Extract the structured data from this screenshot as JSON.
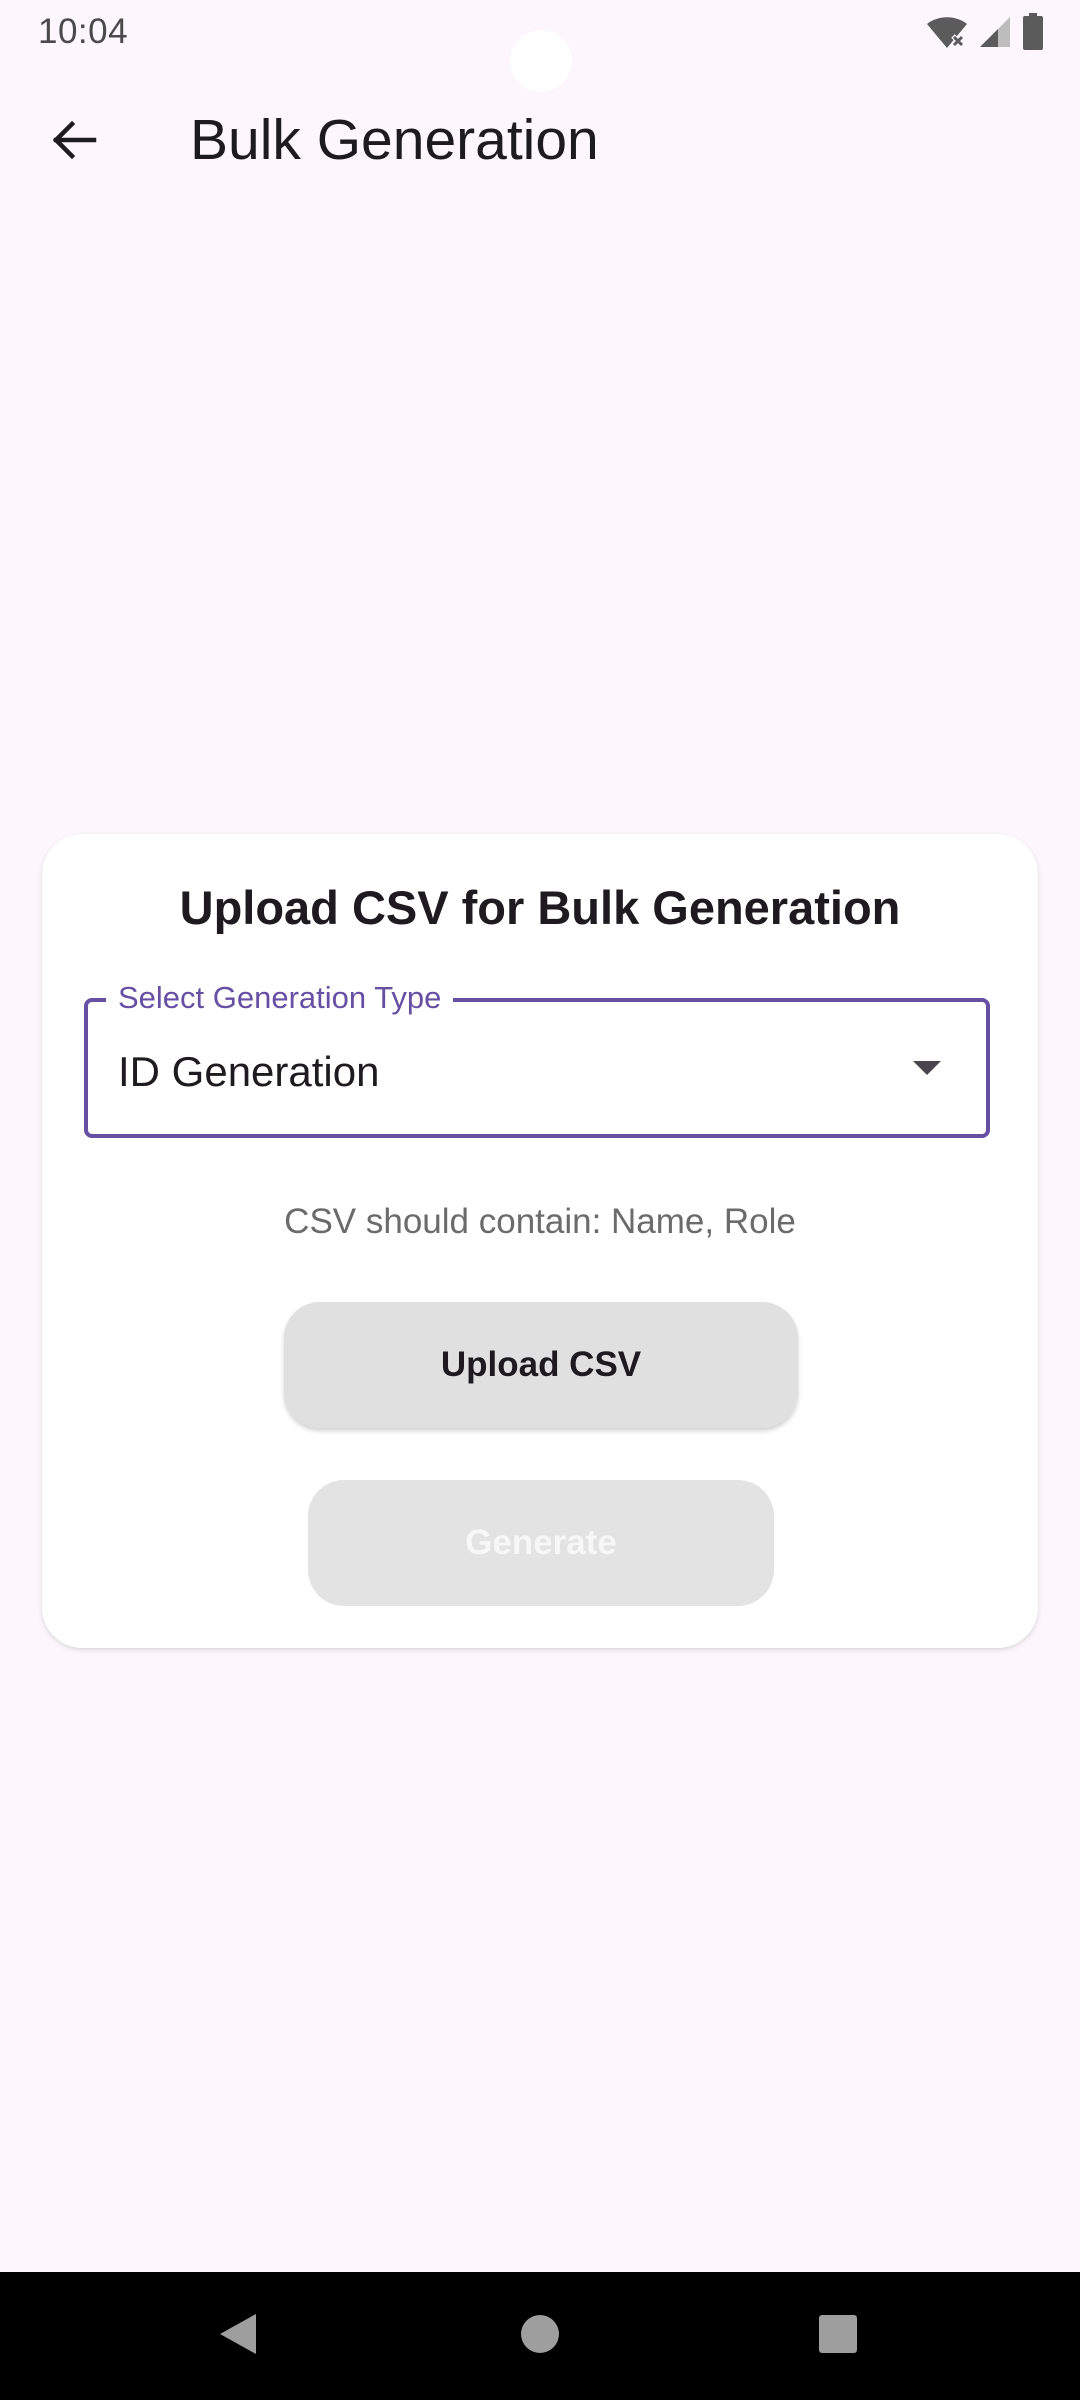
{
  "status_bar": {
    "time": "10:04",
    "icons": [
      "wifi-off-icon",
      "cellular-signal-icon",
      "battery-icon"
    ]
  },
  "app_bar": {
    "back_icon": "arrow-back-icon",
    "title": "Bulk Generation"
  },
  "card": {
    "title": "Upload CSV for Bulk Generation",
    "select": {
      "label": "Select Generation Type",
      "value": "ID Generation",
      "icon": "arrow-drop-down-icon"
    },
    "hint": "CSV should contain: Name, Role",
    "upload_button": "Upload CSV",
    "generate_button": "Generate"
  },
  "nav_bar": {
    "icons": [
      "nav-back-icon",
      "nav-home-icon",
      "nav-recents-icon"
    ]
  },
  "colors": {
    "background": "#fdf7fd",
    "accent": "#6750a4",
    "card": "#ffffff",
    "button": "#e0e0e0",
    "nav_bar": "#000000"
  }
}
